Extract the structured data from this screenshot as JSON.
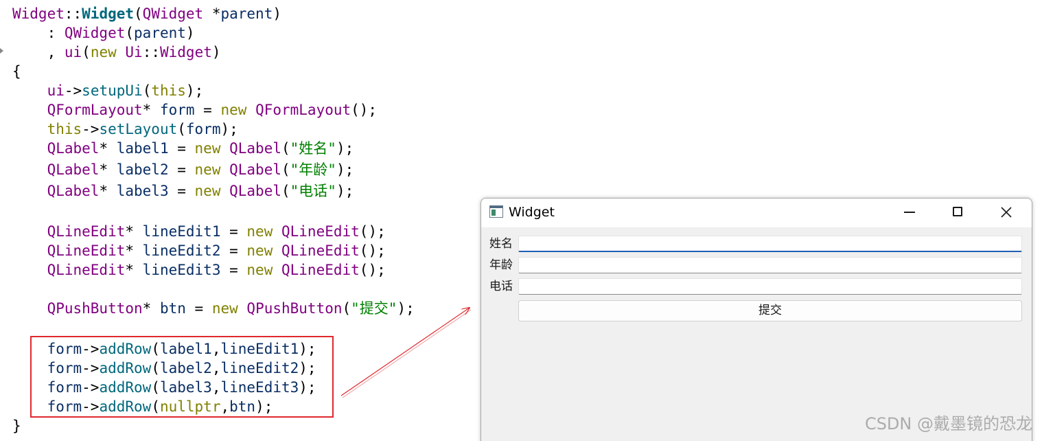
{
  "editor": {
    "lines": [
      {
        "tokens": [
          {
            "t": "Widget",
            "c": "ty"
          },
          {
            "t": "::",
            "c": "pl"
          },
          {
            "t": "Widget",
            "c": "fnb"
          },
          {
            "t": "(",
            "c": "pl"
          },
          {
            "t": "QWidget",
            "c": "ty"
          },
          {
            "t": " *",
            "c": "pl"
          },
          {
            "t": "parent",
            "c": "var"
          },
          {
            "t": ")",
            "c": "pl"
          }
        ]
      },
      {
        "tokens": [
          {
            "t": "    : ",
            "c": "pl"
          },
          {
            "t": "QWidget",
            "c": "ty"
          },
          {
            "t": "(",
            "c": "pl"
          },
          {
            "t": "parent",
            "c": "var"
          },
          {
            "t": ")",
            "c": "pl"
          }
        ]
      },
      {
        "tokens": [
          {
            "t": "    , ",
            "c": "pl"
          },
          {
            "t": "ui",
            "c": "ty"
          },
          {
            "t": "(",
            "c": "pl"
          },
          {
            "t": "new",
            "c": "kw"
          },
          {
            "t": " ",
            "c": "pl"
          },
          {
            "t": "Ui",
            "c": "ty"
          },
          {
            "t": "::",
            "c": "pl"
          },
          {
            "t": "Widget",
            "c": "ty"
          },
          {
            "t": ")",
            "c": "pl"
          }
        ]
      },
      {
        "tokens": [
          {
            "t": "{",
            "c": "pl"
          }
        ]
      },
      {
        "tokens": [
          {
            "t": "    ",
            "c": "pl"
          },
          {
            "t": "ui",
            "c": "ty"
          },
          {
            "t": "->",
            "c": "pl"
          },
          {
            "t": "setupUi",
            "c": "fn"
          },
          {
            "t": "(",
            "c": "pl"
          },
          {
            "t": "this",
            "c": "kw"
          },
          {
            "t": ");",
            "c": "pl"
          }
        ]
      },
      {
        "tokens": [
          {
            "t": "    ",
            "c": "pl"
          },
          {
            "t": "QFormLayout",
            "c": "ty"
          },
          {
            "t": "* ",
            "c": "pl"
          },
          {
            "t": "form",
            "c": "var"
          },
          {
            "t": " = ",
            "c": "pl"
          },
          {
            "t": "new",
            "c": "kw"
          },
          {
            "t": " ",
            "c": "pl"
          },
          {
            "t": "QFormLayout",
            "c": "ty"
          },
          {
            "t": "();",
            "c": "pl"
          }
        ]
      },
      {
        "tokens": [
          {
            "t": "    ",
            "c": "pl"
          },
          {
            "t": "this",
            "c": "kw"
          },
          {
            "t": "->",
            "c": "pl"
          },
          {
            "t": "setLayout",
            "c": "fn"
          },
          {
            "t": "(",
            "c": "pl"
          },
          {
            "t": "form",
            "c": "var"
          },
          {
            "t": ");",
            "c": "pl"
          }
        ]
      },
      {
        "tokens": [
          {
            "t": "    ",
            "c": "pl"
          },
          {
            "t": "QLabel",
            "c": "ty"
          },
          {
            "t": "* ",
            "c": "pl"
          },
          {
            "t": "label1",
            "c": "var"
          },
          {
            "t": " = ",
            "c": "pl"
          },
          {
            "t": "new",
            "c": "kw"
          },
          {
            "t": " ",
            "c": "pl"
          },
          {
            "t": "QLabel",
            "c": "ty"
          },
          {
            "t": "(",
            "c": "pl"
          },
          {
            "t": "\"姓名\"",
            "c": "str"
          },
          {
            "t": ");",
            "c": "pl"
          }
        ]
      },
      {
        "tokens": [
          {
            "t": "    ",
            "c": "pl"
          },
          {
            "t": "QLabel",
            "c": "ty"
          },
          {
            "t": "* ",
            "c": "pl"
          },
          {
            "t": "label2",
            "c": "var"
          },
          {
            "t": " = ",
            "c": "pl"
          },
          {
            "t": "new",
            "c": "kw"
          },
          {
            "t": " ",
            "c": "pl"
          },
          {
            "t": "QLabel",
            "c": "ty"
          },
          {
            "t": "(",
            "c": "pl"
          },
          {
            "t": "\"年龄\"",
            "c": "str"
          },
          {
            "t": ");",
            "c": "pl"
          }
        ]
      },
      {
        "tokens": [
          {
            "t": "    ",
            "c": "pl"
          },
          {
            "t": "QLabel",
            "c": "ty"
          },
          {
            "t": "* ",
            "c": "pl"
          },
          {
            "t": "label3",
            "c": "var"
          },
          {
            "t": " = ",
            "c": "pl"
          },
          {
            "t": "new",
            "c": "kw"
          },
          {
            "t": " ",
            "c": "pl"
          },
          {
            "t": "QLabel",
            "c": "ty"
          },
          {
            "t": "(",
            "c": "pl"
          },
          {
            "t": "\"电话\"",
            "c": "str"
          },
          {
            "t": ");",
            "c": "pl"
          }
        ]
      },
      {
        "tokens": []
      },
      {
        "tokens": [
          {
            "t": "    ",
            "c": "pl"
          },
          {
            "t": "QLineEdit",
            "c": "ty"
          },
          {
            "t": "* ",
            "c": "pl"
          },
          {
            "t": "lineEdit1",
            "c": "var"
          },
          {
            "t": " = ",
            "c": "pl"
          },
          {
            "t": "new",
            "c": "kw"
          },
          {
            "t": " ",
            "c": "pl"
          },
          {
            "t": "QLineEdit",
            "c": "ty"
          },
          {
            "t": "();",
            "c": "pl"
          }
        ]
      },
      {
        "tokens": [
          {
            "t": "    ",
            "c": "pl"
          },
          {
            "t": "QLineEdit",
            "c": "ty"
          },
          {
            "t": "* ",
            "c": "pl"
          },
          {
            "t": "lineEdit2",
            "c": "var"
          },
          {
            "t": " = ",
            "c": "pl"
          },
          {
            "t": "new",
            "c": "kw"
          },
          {
            "t": " ",
            "c": "pl"
          },
          {
            "t": "QLineEdit",
            "c": "ty"
          },
          {
            "t": "();",
            "c": "pl"
          }
        ]
      },
      {
        "tokens": [
          {
            "t": "    ",
            "c": "pl"
          },
          {
            "t": "QLineEdit",
            "c": "ty"
          },
          {
            "t": "* ",
            "c": "pl"
          },
          {
            "t": "lineEdit3",
            "c": "var"
          },
          {
            "t": " = ",
            "c": "pl"
          },
          {
            "t": "new",
            "c": "kw"
          },
          {
            "t": " ",
            "c": "pl"
          },
          {
            "t": "QLineEdit",
            "c": "ty"
          },
          {
            "t": "();",
            "c": "pl"
          }
        ]
      },
      {
        "tokens": []
      },
      {
        "tokens": [
          {
            "t": "    ",
            "c": "pl"
          },
          {
            "t": "QPushButton",
            "c": "ty"
          },
          {
            "t": "* ",
            "c": "pl"
          },
          {
            "t": "btn",
            "c": "var"
          },
          {
            "t": " = ",
            "c": "pl"
          },
          {
            "t": "new",
            "c": "kw"
          },
          {
            "t": " ",
            "c": "pl"
          },
          {
            "t": "QPushButton",
            "c": "ty"
          },
          {
            "t": "(",
            "c": "pl"
          },
          {
            "t": "\"提交\"",
            "c": "str"
          },
          {
            "t": ");",
            "c": "pl"
          }
        ]
      },
      {
        "tokens": []
      },
      {
        "tokens": [
          {
            "t": "    ",
            "c": "pl"
          },
          {
            "t": "form",
            "c": "var"
          },
          {
            "t": "->",
            "c": "pl"
          },
          {
            "t": "addRow",
            "c": "fn"
          },
          {
            "t": "(",
            "c": "pl"
          },
          {
            "t": "label1",
            "c": "var"
          },
          {
            "t": ",",
            "c": "pl"
          },
          {
            "t": "lineEdit1",
            "c": "var"
          },
          {
            "t": ");",
            "c": "pl"
          }
        ]
      },
      {
        "tokens": [
          {
            "t": "    ",
            "c": "pl"
          },
          {
            "t": "form",
            "c": "var"
          },
          {
            "t": "->",
            "c": "pl"
          },
          {
            "t": "addRow",
            "c": "fn"
          },
          {
            "t": "(",
            "c": "pl"
          },
          {
            "t": "label2",
            "c": "var"
          },
          {
            "t": ",",
            "c": "pl"
          },
          {
            "t": "lineEdit2",
            "c": "var"
          },
          {
            "t": ");",
            "c": "pl"
          }
        ]
      },
      {
        "tokens": [
          {
            "t": "    ",
            "c": "pl"
          },
          {
            "t": "form",
            "c": "var"
          },
          {
            "t": "->",
            "c": "pl"
          },
          {
            "t": "addRow",
            "c": "fn"
          },
          {
            "t": "(",
            "c": "pl"
          },
          {
            "t": "label3",
            "c": "var"
          },
          {
            "t": ",",
            "c": "pl"
          },
          {
            "t": "lineEdit3",
            "c": "var"
          },
          {
            "t": ");",
            "c": "pl"
          }
        ]
      },
      {
        "tokens": [
          {
            "t": "    ",
            "c": "pl"
          },
          {
            "t": "form",
            "c": "var"
          },
          {
            "t": "->",
            "c": "pl"
          },
          {
            "t": "addRow",
            "c": "fn"
          },
          {
            "t": "(",
            "c": "pl"
          },
          {
            "t": "nullptr",
            "c": "kw"
          },
          {
            "t": ",",
            "c": "pl"
          },
          {
            "t": "btn",
            "c": "var"
          },
          {
            "t": ");",
            "c": "pl"
          }
        ]
      },
      {
        "tokens": [
          {
            "t": "}",
            "c": "pl"
          }
        ]
      }
    ]
  },
  "annotation": {
    "box_color": "#e0282e",
    "arrow_color": "#e0282e"
  },
  "window": {
    "title": "Widget",
    "icon": "qt-window-icon",
    "controls": {
      "minimize": "minimize-icon",
      "maximize": "maximize-icon",
      "close": "close-icon"
    },
    "form": {
      "rows": [
        {
          "label": "姓名",
          "value": "",
          "focused": true
        },
        {
          "label": "年龄",
          "value": "",
          "focused": false
        },
        {
          "label": "电话",
          "value": "",
          "focused": false
        }
      ],
      "submit_label": "提交"
    }
  },
  "watermark": "CSDN @戴墨镜的恐龙"
}
